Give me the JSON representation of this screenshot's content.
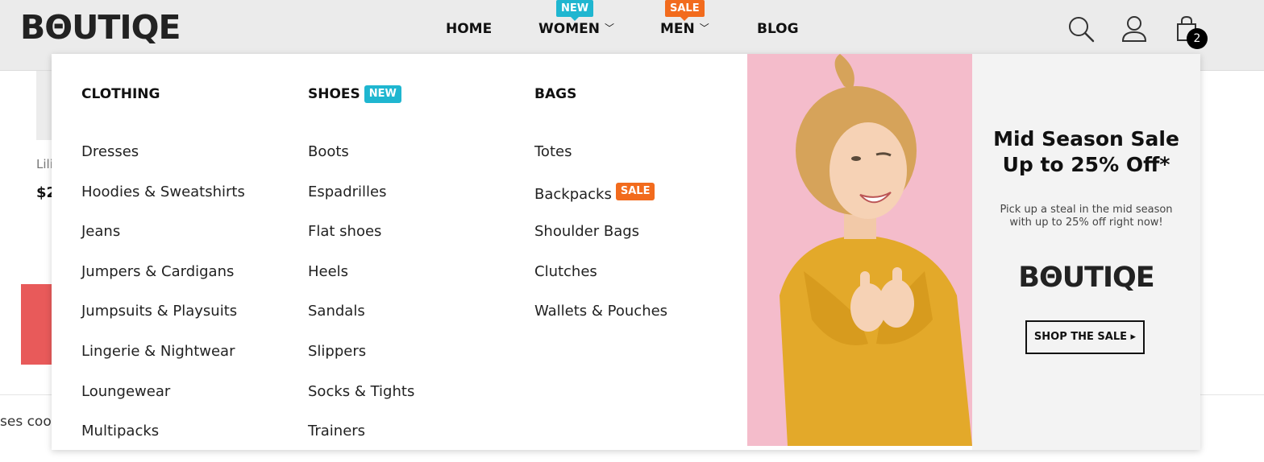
{
  "brand": {
    "logo": "BΘUTIQE"
  },
  "nav": {
    "home": "HOME",
    "women": "WOMEN",
    "women_flag": "NEW",
    "men": "MEN",
    "men_flag": "SALE",
    "blog": "BLOG",
    "chevron": "﹀"
  },
  "header_icons": [
    "search-icon",
    "user-icon",
    "shopping-bag-icon"
  ],
  "cart": {
    "count": "2"
  },
  "background_page": {
    "product_name_partial": "Lili",
    "price_partial": "$2",
    "cookie_text_partial": "ses coo"
  },
  "mega_menu": {
    "clothing": {
      "title": "CLOTHING",
      "items": [
        "Dresses",
        "Hoodies & Sweatshirts",
        "Jeans",
        "Jumpers & Cardigans",
        "Jumpsuits & Playsuits",
        "Lingerie & Nightwear",
        "Loungewear",
        "Multipacks"
      ]
    },
    "shoes": {
      "title": "SHOES",
      "tag": "NEW",
      "items": [
        "Boots",
        "Espadrilles",
        "Flat shoes",
        "Heels",
        "Sandals",
        "Slippers",
        "Socks & Tights",
        "Trainers"
      ]
    },
    "bags": {
      "title": "BAGS",
      "items": [
        "Totes",
        "Backpacks",
        "Shoulder Bags",
        "Clutches",
        "Wallets & Pouches"
      ],
      "backpacks_tag": "SALE"
    }
  },
  "promo": {
    "title_line1": "Mid Season Sale",
    "title_line2": "Up to 25% Off*",
    "text": "Pick up a steal in the mid season with up to 25% off right now!",
    "logo": "BΘUTIQE",
    "button": "SHOP THE SALE ▸"
  },
  "colors": {
    "new_tag": "#1fb6d0",
    "sale_tag": "#f26b1d",
    "header_bg": "#ebebeb",
    "promo_bg": "#f4bccb",
    "sweater": "#e3a92a"
  }
}
